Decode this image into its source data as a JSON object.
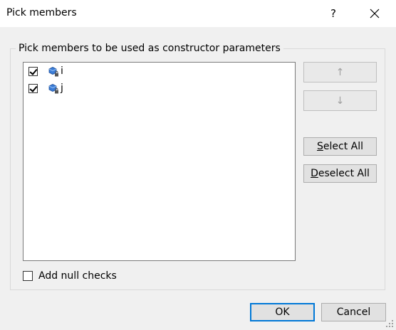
{
  "window": {
    "title": "Pick members",
    "help_label": "?"
  },
  "group": {
    "legend": "Pick members to be used as constructor parameters"
  },
  "members": [
    {
      "name": "i",
      "checked": true
    },
    {
      "name": "j",
      "checked": true
    }
  ],
  "buttons": {
    "move_up": "↑",
    "move_down": "↓",
    "select_all_mnemonic": "S",
    "select_all_rest": "elect All",
    "deselect_all_mnemonic": "D",
    "deselect_all_rest": "eselect All",
    "ok": "OK",
    "cancel": "Cancel"
  },
  "options": {
    "add_null_checks_label": "Add null checks",
    "add_null_checks_checked": false
  },
  "colors": {
    "default_button_border": "#0078d7",
    "field_icon_blue": "#2f6fbf"
  }
}
